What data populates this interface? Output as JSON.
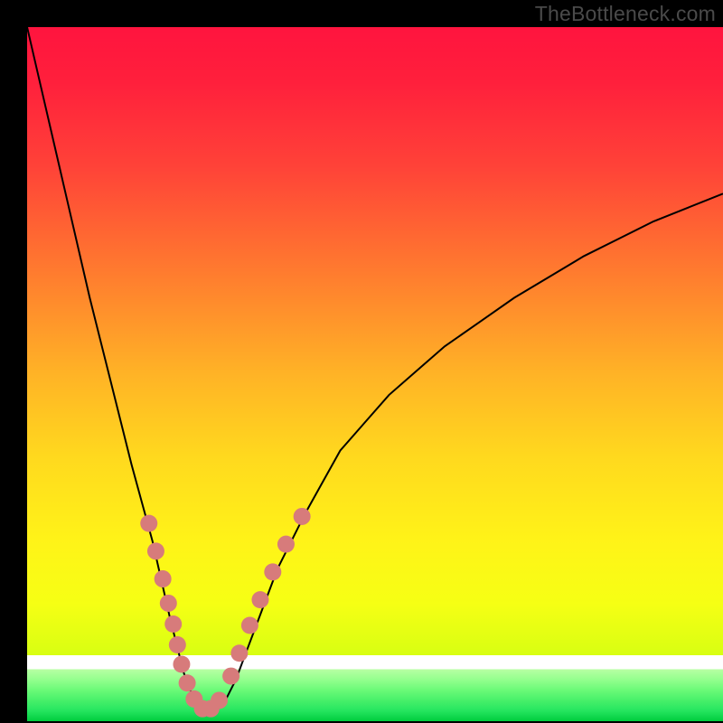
{
  "watermark": "TheBottleneck.com",
  "colors": {
    "frame_bg": "#000000",
    "curve_stroke": "#000000",
    "dot_fill": "#d77b7b",
    "gradient_stops": [
      {
        "offset": 0.0,
        "color": "#ff143e"
      },
      {
        "offset": 0.08,
        "color": "#ff203c"
      },
      {
        "offset": 0.2,
        "color": "#ff4238"
      },
      {
        "offset": 0.35,
        "color": "#ff7a2f"
      },
      {
        "offset": 0.5,
        "color": "#ffb326"
      },
      {
        "offset": 0.62,
        "color": "#ffd91e"
      },
      {
        "offset": 0.74,
        "color": "#fff318"
      },
      {
        "offset": 0.83,
        "color": "#f6ff14"
      },
      {
        "offset": 0.905,
        "color": "#d8ff12"
      },
      {
        "offset": 0.905,
        "color": "#ffffff"
      },
      {
        "offset": 0.925,
        "color": "#ffffff"
      },
      {
        "offset": 0.925,
        "color": "#b8ffa4"
      },
      {
        "offset": 0.94,
        "color": "#94ff8e"
      },
      {
        "offset": 0.955,
        "color": "#6bfa78"
      },
      {
        "offset": 0.97,
        "color": "#47f06a"
      },
      {
        "offset": 0.985,
        "color": "#25e55f"
      },
      {
        "offset": 1.0,
        "color": "#00cd3e"
      }
    ]
  },
  "chart_data": {
    "type": "line",
    "title": "",
    "xlabel": "",
    "ylabel": "",
    "xlim": [
      0,
      1
    ],
    "ylim": [
      0,
      1
    ],
    "note": "Bottleneck-style V curve. x is normalized horizontal position across the colored plot area (0=left edge, 1=right edge). y is normalized vertical position (0=bottom, 1=top). Values estimated from pixel positions.",
    "series": [
      {
        "name": "bottleneck-curve",
        "x": [
          0.0,
          0.03,
          0.06,
          0.09,
          0.12,
          0.15,
          0.18,
          0.205,
          0.225,
          0.24,
          0.255,
          0.27,
          0.285,
          0.3,
          0.33,
          0.36,
          0.4,
          0.45,
          0.52,
          0.6,
          0.7,
          0.8,
          0.9,
          1.0
        ],
        "y": [
          1.0,
          0.87,
          0.74,
          0.61,
          0.49,
          0.37,
          0.26,
          0.15,
          0.07,
          0.03,
          0.015,
          0.015,
          0.03,
          0.06,
          0.14,
          0.22,
          0.3,
          0.39,
          0.47,
          0.54,
          0.61,
          0.67,
          0.72,
          0.76
        ]
      }
    ],
    "dots": {
      "name": "highlighted-points",
      "note": "Salmon-colored circular markers overlaid on the curve near the vertex.",
      "x": [
        0.175,
        0.185,
        0.195,
        0.203,
        0.21,
        0.216,
        0.222,
        0.23,
        0.24,
        0.252,
        0.264,
        0.276,
        0.293,
        0.305,
        0.32,
        0.335,
        0.353,
        0.372,
        0.395
      ],
      "y": [
        0.285,
        0.245,
        0.205,
        0.17,
        0.14,
        0.11,
        0.082,
        0.055,
        0.032,
        0.018,
        0.018,
        0.03,
        0.065,
        0.098,
        0.138,
        0.175,
        0.215,
        0.255,
        0.295
      ]
    }
  }
}
